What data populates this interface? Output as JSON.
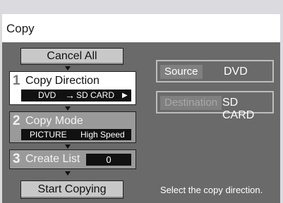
{
  "title": "Copy",
  "cancel_all": "Cancel All",
  "steps": [
    {
      "num": "1",
      "label": "Copy Direction",
      "source": "DVD",
      "arrow": "→",
      "dest": "SD CARD",
      "more": "▶"
    },
    {
      "num": "2",
      "label": "Copy Mode",
      "mode": "PICTURE",
      "speed": "High Speed"
    },
    {
      "num": "3",
      "label": "Create List",
      "count": "0"
    }
  ],
  "start_copying": "Start Copying",
  "source_field": {
    "tag": "Source",
    "value": "DVD"
  },
  "destination_field": {
    "tag": "Destination",
    "value": "SD CARD"
  },
  "hint": "Select the copy direction."
}
